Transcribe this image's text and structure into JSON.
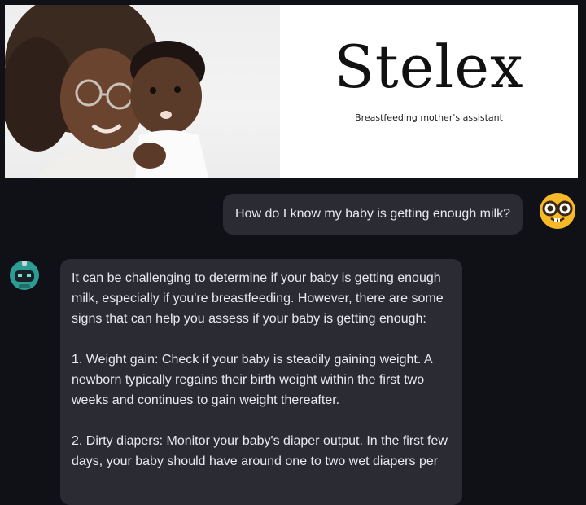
{
  "banner": {
    "brand_title": "Stelex",
    "brand_subtitle": "Breastfeeding mother's assistant"
  },
  "chat": {
    "user_message": "How do I know my baby is getting enough milk?",
    "bot_paragraphs": [
      "It can be challenging to determine if your baby is getting enough milk, especially if you're breastfeeding. However, there are some signs that can help you assess if your baby is getting enough:",
      "1. Weight gain: Check if your baby is steadily gaining weight. A newborn typically regains their birth weight within the first two weeks and continues to gain weight thereafter.",
      "2. Dirty diapers: Monitor your baby's diaper output. In the first few days, your baby should have around one to two wet diapers per"
    ]
  },
  "icons": {
    "user_avatar": "nerd-face-emoji-icon",
    "bot_avatar": "robot-icon"
  },
  "colors": {
    "background": "#0f1117",
    "bubble": "#2a2b33",
    "text": "#e9e9ee",
    "avatar_yellow": "#f7b928",
    "robot_teal": "#2a9d94"
  }
}
